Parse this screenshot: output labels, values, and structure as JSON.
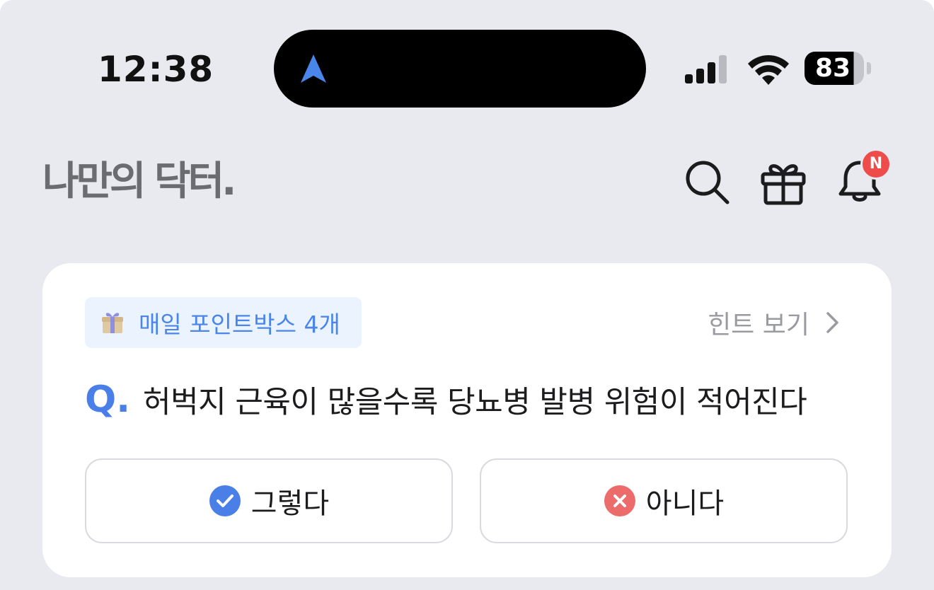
{
  "status_bar": {
    "time": "12:38",
    "battery": "83",
    "icons": [
      "navigation-arrow-icon",
      "cellular-signal-icon",
      "wifi-icon",
      "battery-icon"
    ]
  },
  "header": {
    "logo": "나만의 닥터.",
    "icons": [
      "search-icon",
      "gift-icon",
      "bell-icon"
    ],
    "notification_badge": "N"
  },
  "quiz_card": {
    "point_badge": "매일 포인트박스 4개",
    "hint_label": "힌트 보기",
    "question_prefix": "Q.",
    "question": "허벅지 근육이 많을수록 당뇨병 발병 위험이 적어진다",
    "answers": [
      {
        "label": "그렇다",
        "icon": "check-circle-icon",
        "color": "#4a7fe8"
      },
      {
        "label": "아니다",
        "icon": "x-circle-icon",
        "color": "#ec6b6b"
      }
    ]
  },
  "colors": {
    "background": "#e9eaef",
    "accent_blue": "#4a86ea",
    "badge_red": "#ee4b4b"
  }
}
